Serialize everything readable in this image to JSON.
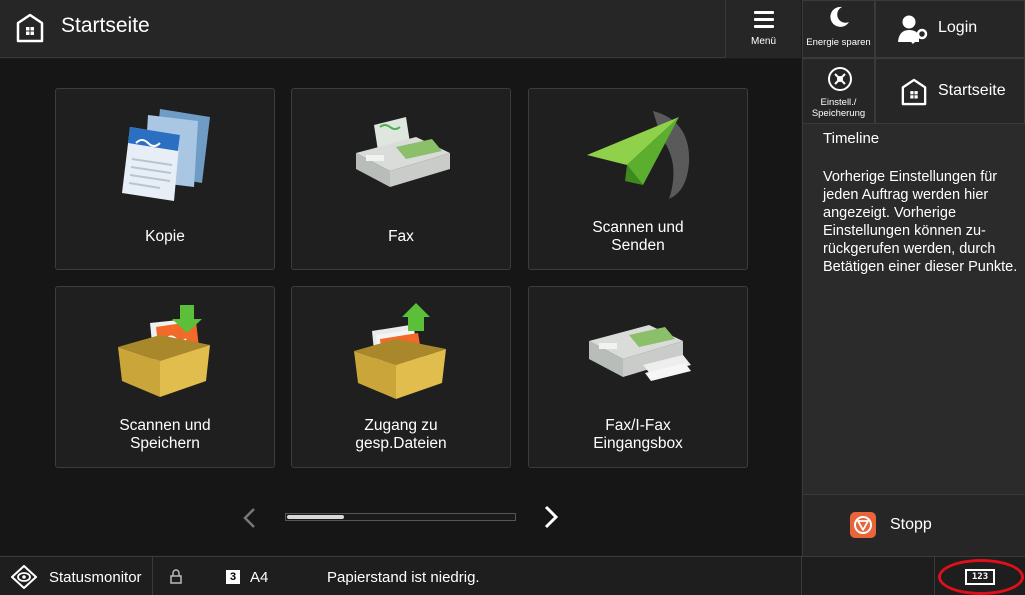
{
  "header": {
    "title": "Startseite",
    "menu_label": "Menü"
  },
  "tiles": [
    {
      "label": "Kopie",
      "icon": "copy-icon"
    },
    {
      "label": "Fax",
      "icon": "fax-icon"
    },
    {
      "label": "Scannen und Senden",
      "line1": "Scannen und",
      "line2": "Senden",
      "icon": "scan-send-icon"
    },
    {
      "label": "Scannen und Speichern",
      "line1": "Scannen und",
      "line2": "Speichern",
      "icon": "scan-store-icon"
    },
    {
      "label": "Zugang zu gesp.Dateien",
      "line1": "Zugang zu",
      "line2": "gesp.Dateien",
      "icon": "stored-files-icon"
    },
    {
      "label": "Fax/I-Fax Eingangsbox",
      "line1": "Fax/I-Fax",
      "line2": "Eingangsbox",
      "icon": "fax-inbox-icon"
    }
  ],
  "pager": {
    "position": 0.25
  },
  "right_panel": {
    "energy_label": "Energie sparen",
    "login_label": "Login",
    "settings_line1": "Einstell./",
    "settings_line2": "Speicherung",
    "home_label": "Startseite",
    "timeline_title": "Timeline",
    "timeline_text": "Vorherige Einstellungen für jeden Auftrag werden hier angezeigt. Vorherige Einstellungen können zu­rückgerufen werden, durch Betätigen einer dieser Punkte.",
    "stop_label": "Stopp"
  },
  "status_bar": {
    "status_monitor_label": "Statusmonitor",
    "tray_number": "3",
    "paper_size": "A4",
    "message": "Papierstand ist niedrig.",
    "keyboard_label": "123"
  },
  "colors": {
    "background": "#161616",
    "stop_accent": "#e8643a",
    "highlight_oval": "#e0101a"
  }
}
